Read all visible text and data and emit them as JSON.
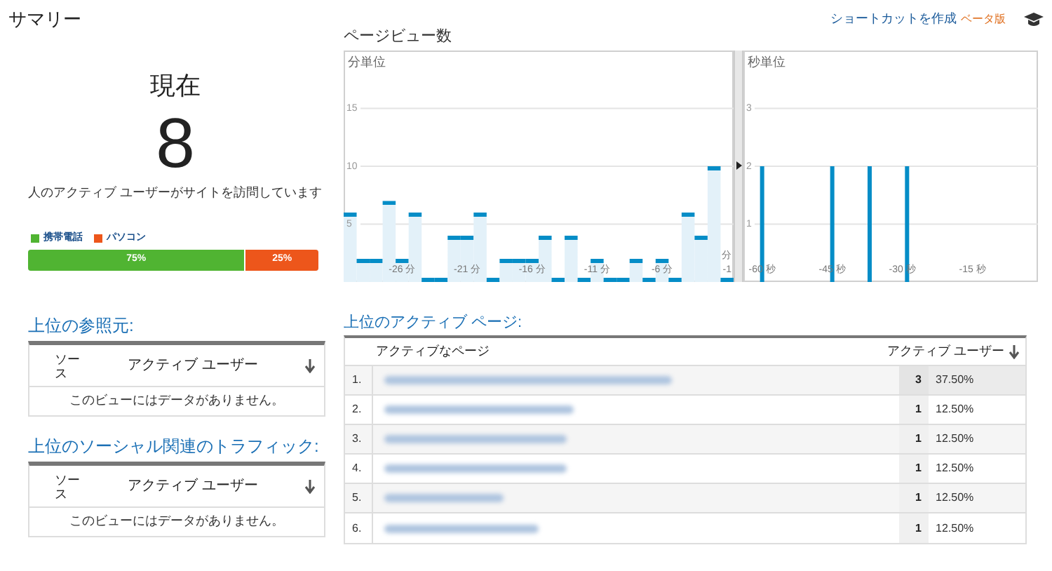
{
  "header": {
    "title": "サマリー",
    "shortcut_link": "ショートカットを作成",
    "beta_badge": "ベータ版"
  },
  "now": {
    "heading": "現在",
    "count": "8",
    "caption": "人のアクティブ ユーザーがサイトを訪問しています",
    "devices": [
      {
        "label": "携帯電話",
        "color": "#50b432",
        "level": 0.75,
        "reading": "75%"
      },
      {
        "label": "パソコン",
        "color": "#ed561b",
        "level": 0.25,
        "reading": "25%"
      }
    ]
  },
  "pageviews": {
    "title": "ページビュー数",
    "minutes": {
      "label": "分単位",
      "chart_data": {
        "type": "bar",
        "x": [
          -30,
          -29,
          -28,
          -27,
          -26,
          -25,
          -24,
          -23,
          -22,
          -21,
          -20,
          -19,
          -18,
          -17,
          -16,
          -15,
          -14,
          -13,
          -12,
          -11,
          -10,
          -9,
          -8,
          -7,
          -6,
          -5,
          -4,
          -3,
          -2,
          -1
        ],
        "values": [
          6,
          2,
          2,
          7,
          2,
          6,
          0,
          0,
          4,
          4,
          6,
          0,
          2,
          2,
          2,
          4,
          0,
          4,
          0,
          2,
          0,
          0,
          2,
          0,
          2,
          0,
          6,
          4,
          10,
          0
        ],
        "xlim": [
          -30.5,
          -0.5
        ],
        "ylim": [
          0,
          20
        ],
        "grid": true,
        "yticks": [
          5,
          10,
          15
        ],
        "xticks": [
          {
            "value": -26,
            "label": "-26 分"
          },
          {
            "value": -21,
            "label": "-21 分"
          },
          {
            "value": -16,
            "label": "-16 分"
          },
          {
            "value": -11,
            "label": "-11 分"
          },
          {
            "value": -6,
            "label": "-6 分"
          },
          {
            "value": -1,
            "label": "-1"
          }
        ],
        "xlabel": "分"
      }
    },
    "seconds": {
      "label": "秒単位",
      "chart_data": {
        "type": "bar",
        "x": [
          -60,
          -45,
          -37,
          -29
        ],
        "values": [
          2,
          2,
          2,
          2
        ],
        "xlim": [
          -64,
          -1
        ],
        "ylim": [
          0,
          4
        ],
        "grid": true,
        "yticks": [
          1,
          2,
          3
        ],
        "xticks": [
          {
            "value": -60,
            "label": "-60 秒"
          },
          {
            "value": -45,
            "label": "-45 秒"
          },
          {
            "value": -30,
            "label": "-30 秒"
          },
          {
            "value": -15,
            "label": "-15 秒"
          }
        ]
      }
    }
  },
  "referrals": {
    "title": "上位の参照元:",
    "columns": [
      "ソース",
      "アクティブ ユーザー"
    ],
    "empty": "このビューにはデータがありません。"
  },
  "social": {
    "title": "上位のソーシャル関連のトラフィック:",
    "columns": [
      "ソース",
      "アクティブ ユーザー"
    ],
    "empty": "このビューにはデータがありません。"
  },
  "pages": {
    "title": "上位のアクティブ ページ:",
    "columns": [
      "アクティブなページ",
      "アクティブ ユーザー"
    ],
    "rows": [
      {
        "index": "1.",
        "users": "3",
        "share": "37.50%"
      },
      {
        "index": "2.",
        "users": "1",
        "share": "12.50%"
      },
      {
        "index": "3.",
        "users": "1",
        "share": "12.50%"
      },
      {
        "index": "4.",
        "users": "1",
        "share": "12.50%"
      },
      {
        "index": "5.",
        "users": "1",
        "share": "12.50%"
      },
      {
        "index": "6.",
        "users": "1",
        "share": "12.50%"
      }
    ]
  }
}
